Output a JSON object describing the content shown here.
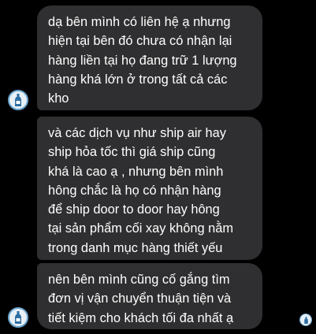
{
  "messages": [
    {
      "text": "dạ bên mình có liên hệ ạ nhưng\nhiện tại bên đó chưa có nhận lại\nhàng liền tại họ đang trữ 1 lượng\nhàng khá lớn ở trong tất cả các\nkho"
    },
    {
      "text": "và các dịch vụ như ship air hay\nship hỏa tốc thì giá ship cũng\nkhá là cao ạ , nhưng bên mình\nhông chắc là họ có nhận hàng\nđể ship door to door hay hông\ntại sản phẩm cối xay không nằm\ntrong danh mục hàng thiết yếu"
    },
    {
      "text": "nên bên mình cũng cố gắng tìm\nđơn vị vận chuyển thuận tiện và\ntiết kiệm cho khách tối đa nhất ạ"
    }
  ],
  "icons": {
    "sender_avatar": "bottle-avatar-icon",
    "seen_indicator": "seen-avatar-icon"
  },
  "colors": {
    "background": "#000000",
    "bubble": "#2f2f31",
    "text": "#ffffff",
    "avatar_ring": "#6aa3cc"
  }
}
